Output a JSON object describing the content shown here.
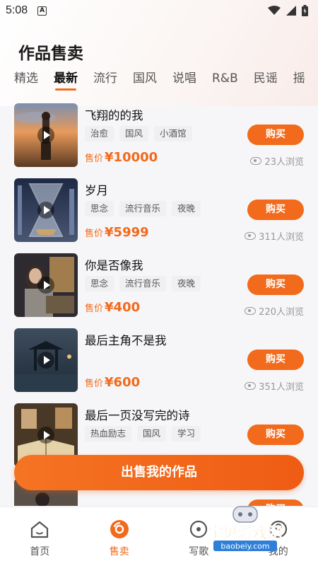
{
  "status_bar": {
    "time": "5:08",
    "a_badge": "A"
  },
  "page_title": "作品售卖",
  "tabs": [
    "精选",
    "最新",
    "流行",
    "国风",
    "说唱",
    "R&B",
    "民谣",
    "摇"
  ],
  "active_tab": "最新",
  "price_prefix": "售价",
  "buy_label": "购买",
  "items": [
    {
      "title": "飞翔的的我",
      "tags": [
        "治愈",
        "国风",
        "小酒馆"
      ],
      "price": "¥10000",
      "views": "23人浏览"
    },
    {
      "title": "岁月",
      "tags": [
        "思念",
        "流行音乐",
        "夜晚"
      ],
      "price": "¥5999",
      "views": "311人浏览"
    },
    {
      "title": "你是否像我",
      "tags": [
        "思念",
        "流行音乐",
        "夜晚"
      ],
      "price": "¥400",
      "views": "220人浏览"
    },
    {
      "title": "最后主角不是我",
      "tags": [],
      "price": "¥600",
      "views": "351人浏览"
    },
    {
      "title": "最后一页没写完的诗",
      "tags": [
        "热血励志",
        "国风",
        "学习"
      ],
      "price": "",
      "views": ""
    },
    {
      "title": "",
      "tags": [],
      "price": "",
      "views": ""
    }
  ],
  "sell_button": "出售我的作品",
  "bottom_nav": [
    {
      "label": "首页",
      "icon": "home-icon"
    },
    {
      "label": "售卖",
      "icon": "sell-icon"
    },
    {
      "label": "写歌",
      "icon": "write-song-icon"
    },
    {
      "label": "我的",
      "icon": "profile-icon"
    }
  ],
  "active_nav": "售卖",
  "watermark": {
    "title": "宝贝游戏网",
    "url": "baobeiy.com"
  },
  "colors": {
    "accent": "#f26a1b",
    "tag_bg": "#f0f0f2",
    "price": "#f26a1b"
  }
}
